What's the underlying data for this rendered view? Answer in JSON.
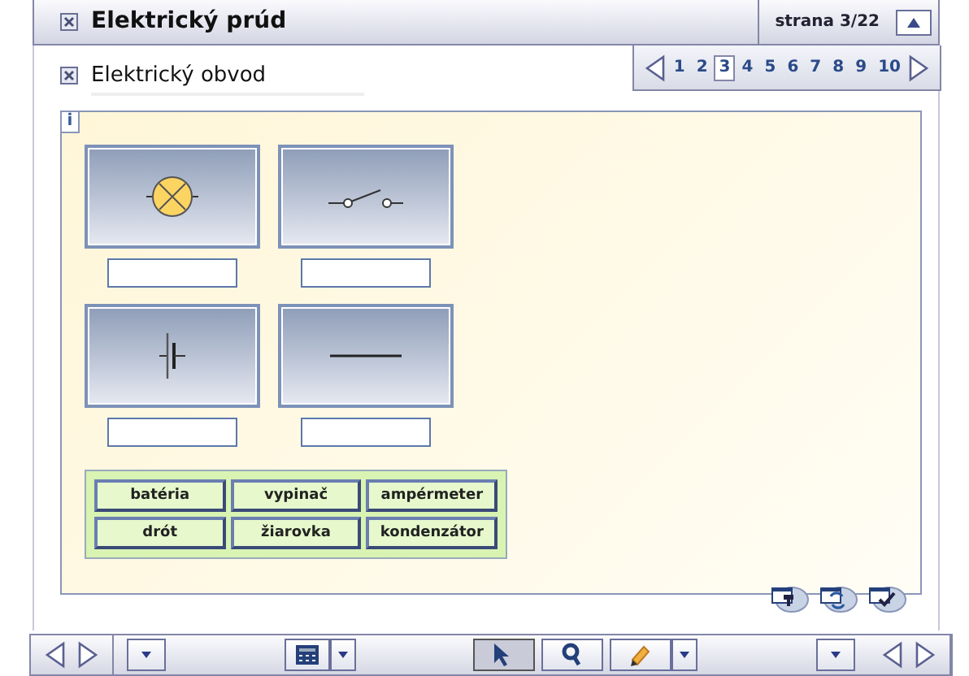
{
  "header": {
    "title": "Elektrický prúd",
    "page_label": "strana 3/22"
  },
  "section": {
    "title": "Elektrický obvod"
  },
  "pages": [
    {
      "label": "1",
      "selected": false
    },
    {
      "label": "2",
      "selected": false
    },
    {
      "label": "3",
      "selected": true
    },
    {
      "label": "4",
      "selected": false
    },
    {
      "label": "5",
      "selected": false
    },
    {
      "label": "6",
      "selected": false
    },
    {
      "label": "7",
      "selected": false
    },
    {
      "label": "8",
      "selected": false
    },
    {
      "label": "9",
      "selected": false
    },
    {
      "label": "10",
      "selected": false
    }
  ],
  "info_tab": {
    "label": "i"
  },
  "cards": [
    {
      "kind": "lamp"
    },
    {
      "kind": "switch"
    },
    {
      "kind": "battery"
    },
    {
      "kind": "wire"
    }
  ],
  "word_bank": [
    "batéria",
    "vypinač",
    "ampérmeter",
    "drót",
    "žiarovka",
    "kondenzátor"
  ],
  "tools": [
    {
      "kind": "pointer",
      "selected": true
    },
    {
      "kind": "magnifier",
      "selected": false
    },
    {
      "kind": "pencil",
      "selected": false
    }
  ]
}
